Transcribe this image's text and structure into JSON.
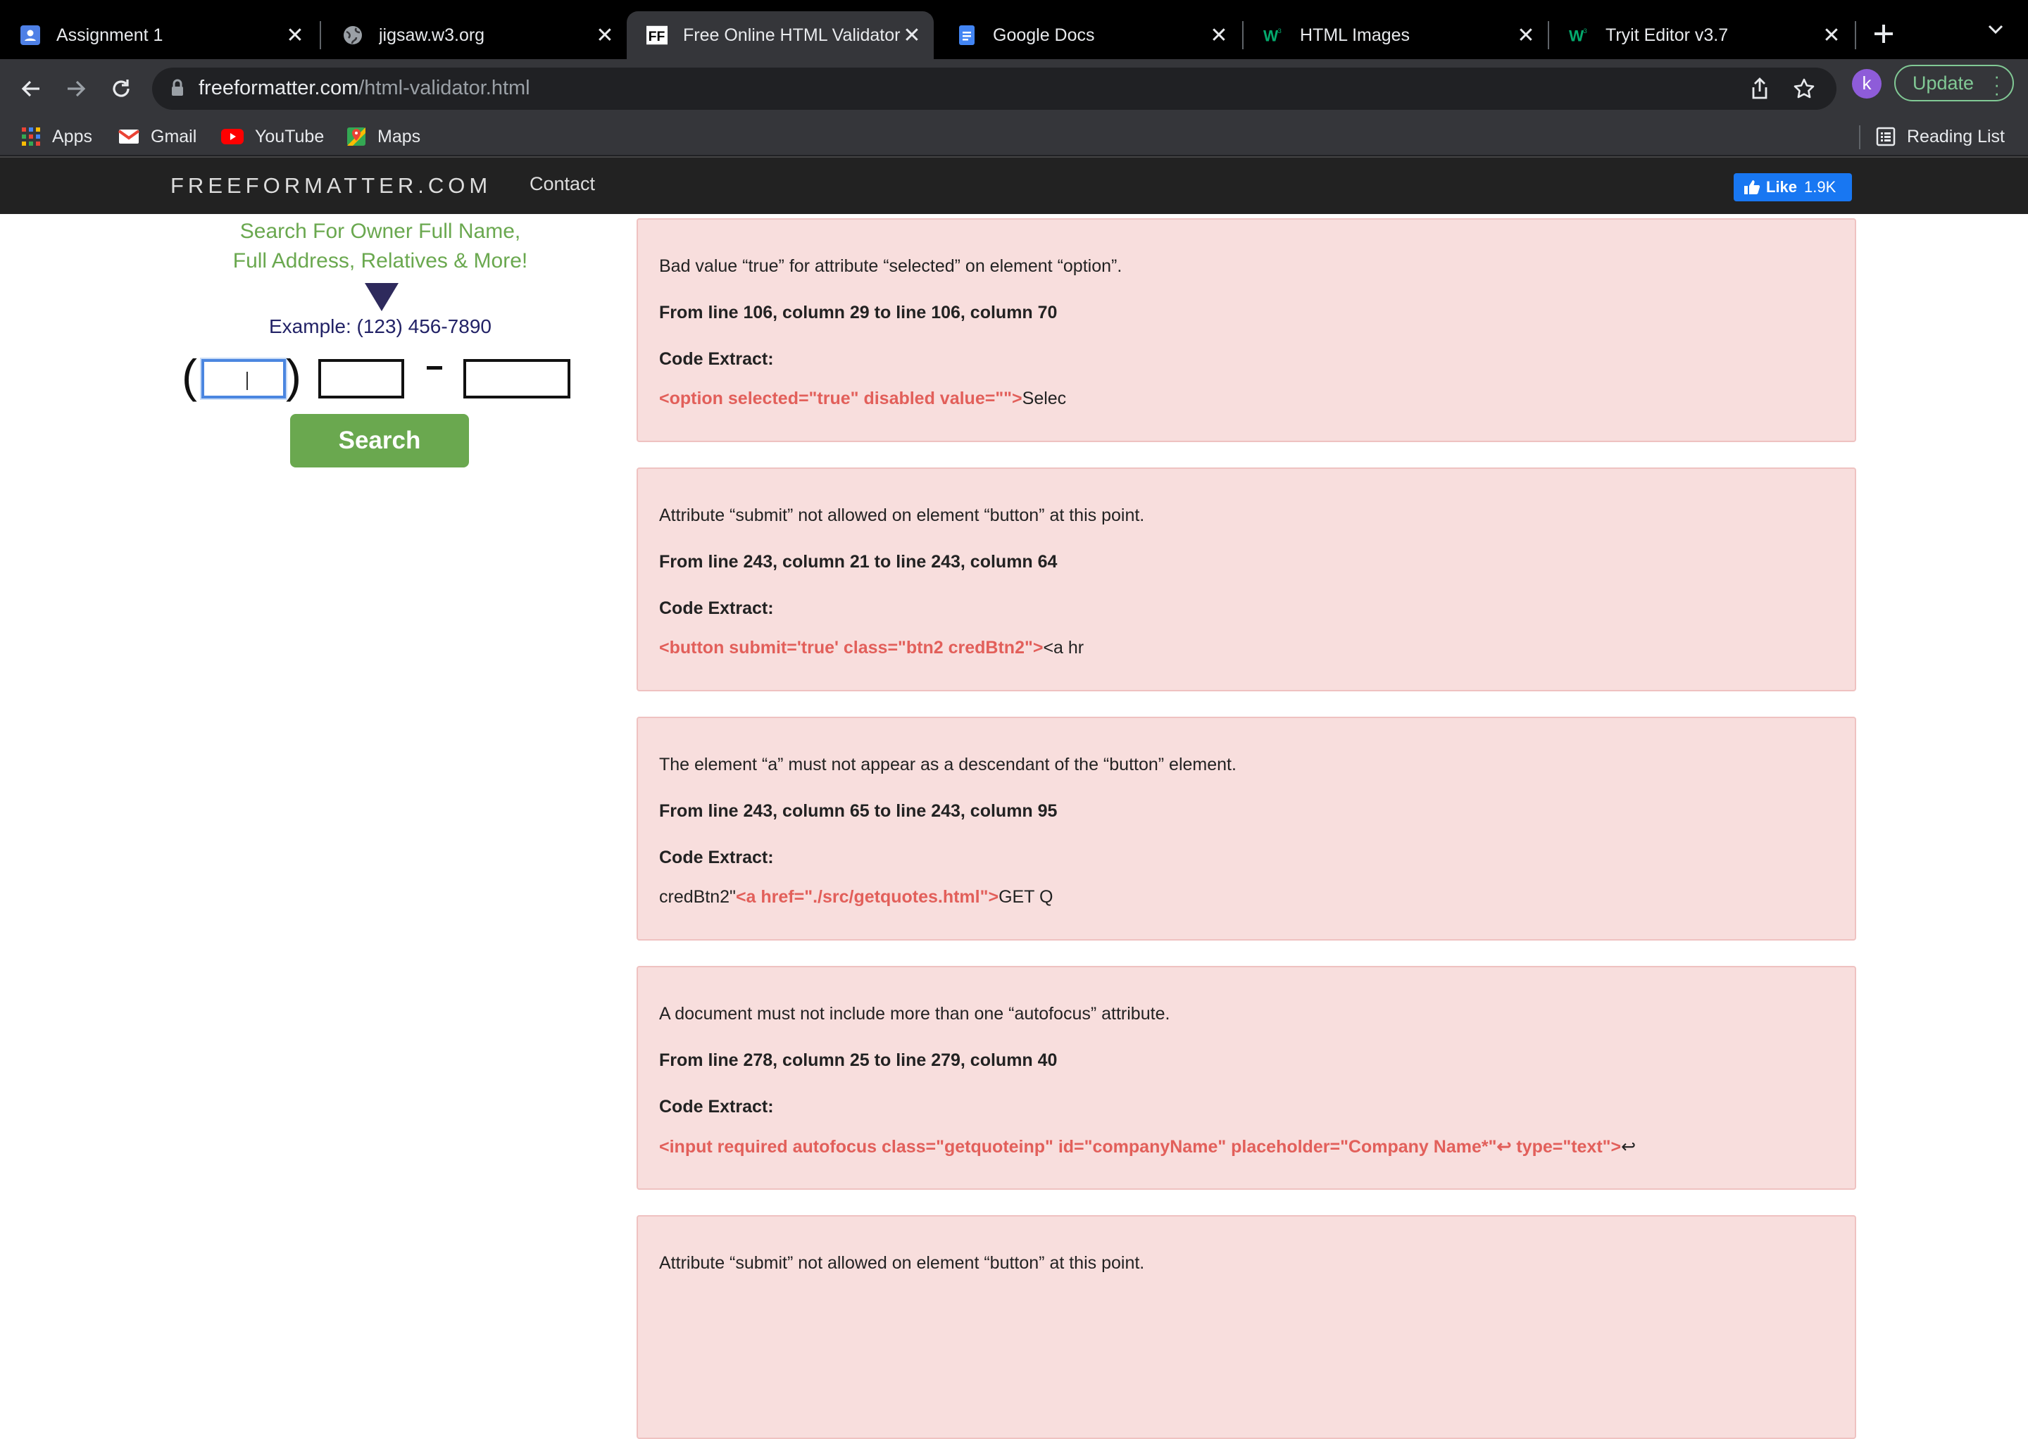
{
  "browser": {
    "tabs": [
      {
        "title": "Assignment 1",
        "icon": "person-badge-icon"
      },
      {
        "title": "jigsaw.w3.org",
        "icon": "globe-icon"
      },
      {
        "title": "Free Online HTML Validator",
        "icon": "ff-logo-icon",
        "active": true
      },
      {
        "title": "Google Docs",
        "icon": "docs-icon"
      },
      {
        "title": "HTML Images",
        "icon": "w3-icon"
      },
      {
        "title": "Tryit Editor v3.7",
        "icon": "w3-icon"
      }
    ],
    "close_glyph": "✕",
    "url_domain": "freeformatter.com",
    "url_path": "/html-validator.html",
    "profile_initial": "k",
    "update_label": "Update",
    "bookmarks": [
      "Apps",
      "Gmail",
      "YouTube",
      "Maps"
    ],
    "reading_list": "Reading List"
  },
  "site": {
    "brand": "FREEFORMATTER.COM",
    "nav_contact": "Contact",
    "fb_like_label": "Like",
    "fb_like_count": "1.9K"
  },
  "ad": {
    "line1": "Search For Owner Full Name,",
    "line2": "Full Address, Relatives & More!",
    "example": "Example: (123) 456-7890",
    "search_label": "Search"
  },
  "results": {
    "code_extract_label": "Code Extract:",
    "errors": [
      {
        "message": "Bad value “true” for attribute “selected” on element “option”.",
        "location": "From line 106, column 29 to line 106, column 70",
        "code_pre": "",
        "code_hl": "<option selected=\"true\" disabled value=\"\">",
        "code_post": "Selec"
      },
      {
        "message": "Attribute “submit” not allowed on element “button” at this point.",
        "location": "From line 243, column 21 to line 243, column 64",
        "code_pre": "",
        "code_hl": "<button submit='true' class=\"btn2 credBtn2\">",
        "code_post": "<a hr"
      },
      {
        "message": "The element “a” must not appear as a descendant of the “button” element.",
        "location": "From line 243, column 65 to line 243, column 95",
        "code_pre": "credBtn2\"",
        "code_hl": "<a href=\"./src/getquotes.html\">",
        "code_post": "GET Q"
      },
      {
        "message": "A document must not include more than one “autofocus” attribute.",
        "location": "From line 278, column 25 to line 279, column 40",
        "code_pre": "",
        "code_hl": "<input required autofocus class=\"getquoteinp\" id=\"companyName\" placeholder=\"Company Name*\"↩ type=\"text\">",
        "code_post": "↩"
      },
      {
        "message": "Attribute “submit” not allowed on element “button” at this point.",
        "location": "",
        "code_pre": "",
        "code_hl": "",
        "code_post": ""
      }
    ]
  },
  "colors": {
    "accent_green": "#6aa84f",
    "error_bg": "#f8dedd",
    "code_highlight": "#e25f5a",
    "facebook_blue": "#1877f2"
  }
}
